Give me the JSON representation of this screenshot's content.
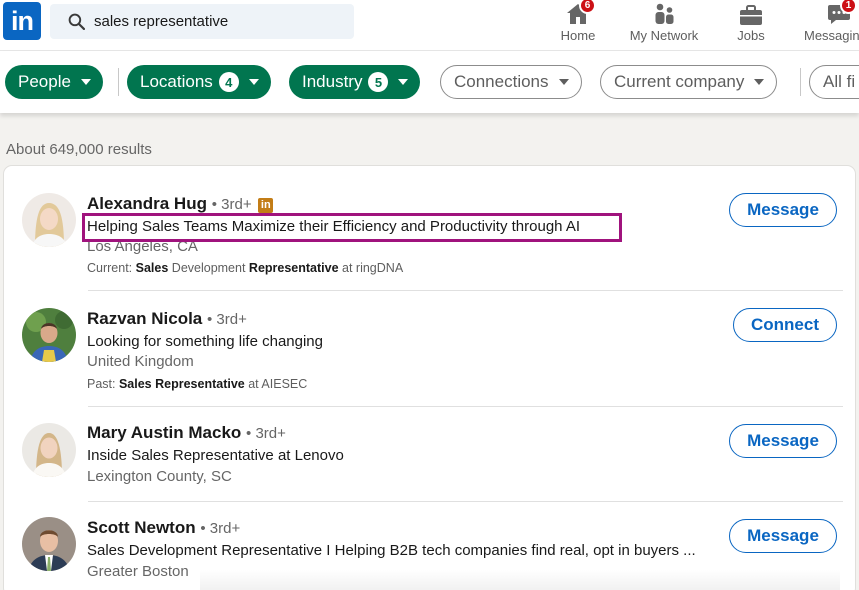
{
  "search": {
    "value": "sales representative"
  },
  "logo_text": "in",
  "nav": [
    {
      "label": "Home",
      "badge": "6",
      "icon": "home-icon"
    },
    {
      "label": "My Network",
      "icon": "network-icon"
    },
    {
      "label": "Jobs",
      "icon": "briefcase-icon"
    },
    {
      "label": "Messaging",
      "badge": "1",
      "icon": "messaging-icon"
    }
  ],
  "filters": [
    {
      "label": "People",
      "active": true
    },
    {
      "label": "Locations",
      "count": "4",
      "active": true
    },
    {
      "label": "Industry",
      "count": "5",
      "active": true
    },
    {
      "label": "Connections",
      "active": false
    },
    {
      "label": "Current company",
      "active": false
    },
    {
      "label": "All fi",
      "active": false
    }
  ],
  "results_count": "About 649,000 results",
  "results": [
    {
      "name": "Alexandra Hug",
      "degree": "• 3rd+",
      "headline": "Helping Sales Teams Maximize their Efficiency and Productivity through AI",
      "location": "Los Angeles, CA",
      "meta_prefix": "Current: ",
      "meta_b1": "Sales",
      "meta_mid": " Development ",
      "meta_b2": "Representative",
      "meta_suffix": " at ringDNA",
      "action": "Message"
    },
    {
      "name": "Razvan Nicola",
      "degree": "• 3rd+",
      "headline": "Looking for something life changing",
      "location": "United Kingdom",
      "meta_prefix": "Past: ",
      "meta_b1": "Sales Representative",
      "meta_suffix": " at AIESEC",
      "action": "Connect"
    },
    {
      "name": "Mary Austin Macko",
      "degree": "• 3rd+",
      "headline": "Inside Sales Representative at Lenovo",
      "location": "Lexington County, SC",
      "action": "Message"
    },
    {
      "name": "Scott Newton",
      "degree": "• 3rd+",
      "headline": "Sales Development Representative I Helping B2B tech companies find real, opt in buyers ...",
      "location": "Greater Boston",
      "action": "Message"
    }
  ],
  "colors": {
    "brand": "#0a66c2",
    "filter_active": "#01754f",
    "highlight_box": "#a0137d",
    "badge": "#cc1016"
  }
}
